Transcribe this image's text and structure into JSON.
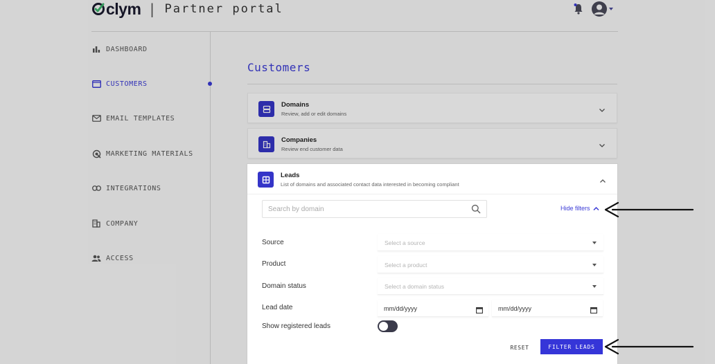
{
  "header": {
    "brand": "clym",
    "separator": "|",
    "subtitle": "Partner portal"
  },
  "sidebar": {
    "items": [
      {
        "label": "DASHBOARD",
        "icon": "bar-chart-icon",
        "active": false
      },
      {
        "label": "CUSTOMERS",
        "icon": "folder-icon",
        "active": true
      },
      {
        "label": "EMAIL TEMPLATES",
        "icon": "mail-icon",
        "active": false
      },
      {
        "label": "MARKETING MATERIALS",
        "icon": "megaphone-icon",
        "active": false
      },
      {
        "label": "INTEGRATIONS",
        "icon": "link-icon",
        "active": false
      },
      {
        "label": "COMPANY",
        "icon": "building-icon",
        "active": false
      },
      {
        "label": "ACCESS",
        "icon": "people-icon",
        "active": false
      }
    ]
  },
  "main": {
    "title": "Customers",
    "panels": [
      {
        "title": "Domains",
        "subtitle": "Review, add or edit domains",
        "icon": "server-icon",
        "expanded": false
      },
      {
        "title": "Companies",
        "subtitle": "Review end customer data",
        "icon": "building-icon",
        "expanded": false
      },
      {
        "title": "Leads",
        "subtitle": "List of domains and associated contact data interested in becoming compliant",
        "icon": "grid-icon",
        "expanded": true
      }
    ],
    "leads": {
      "search_placeholder": "Search by domain",
      "hide_filters": "Hide filters",
      "filters": {
        "source": {
          "label": "Source",
          "placeholder": "Select a source"
        },
        "product": {
          "label": "Product",
          "placeholder": "Select a product"
        },
        "domain_status": {
          "label": "Domain status",
          "placeholder": "Select a domain status"
        },
        "lead_date": {
          "label": "Lead date",
          "from": "mm/dd/yyyy",
          "to": "mm/dd/yyyy"
        },
        "show_registered": {
          "label": "Show registered leads",
          "value": false
        }
      },
      "reset_label": "RESET",
      "filter_label": "FILTER LEADS"
    }
  },
  "colors": {
    "accent": "#3535d8",
    "nav_active": "#3a3ad6",
    "toggle_off": "#3a3a4a"
  }
}
